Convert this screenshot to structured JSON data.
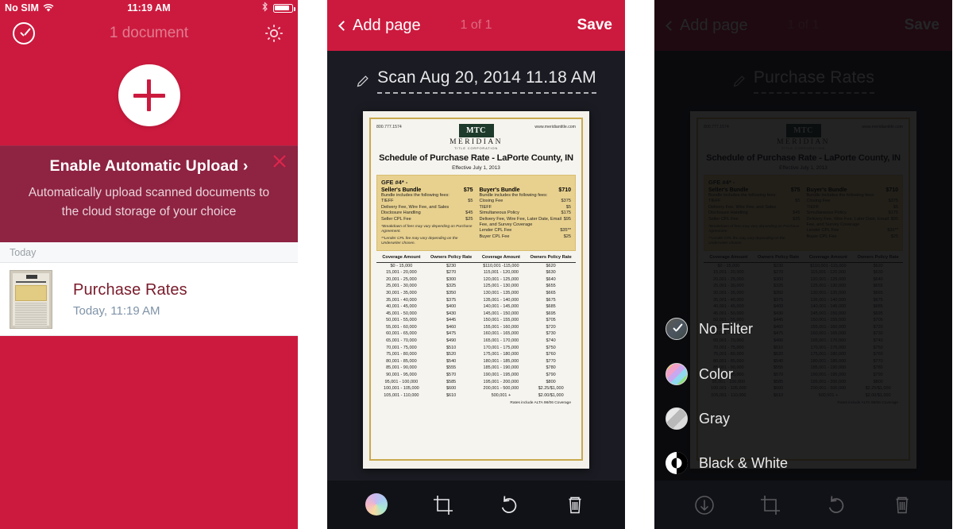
{
  "brand": {
    "red": "#CC1A3E",
    "banner_maroon": "#8E2342",
    "dark": "#1B1C23"
  },
  "panel1": {
    "status_bar": {
      "carrier": "No SIM",
      "time": "11:19 AM",
      "wifi_icon": "wifi-icon",
      "bluetooth_icon": "bluetooth-icon",
      "battery_icon": "battery-icon"
    },
    "navbar": {
      "select_icon": "check-circle-icon",
      "title": "1 document",
      "settings_icon": "gear-icon"
    },
    "add_button": {
      "icon": "plus-icon",
      "label": ""
    },
    "banner": {
      "title": "Enable Automatic Upload ›",
      "subtitle": "Automatically upload scanned documents to the cloud storage of your choice",
      "close_icon": "close-icon"
    },
    "list": {
      "section_header": "Today",
      "items": [
        {
          "title": "Purchase Rates",
          "subtitle": "Today, 11:19 AM",
          "thumbnail": "document-thumbnail"
        }
      ]
    }
  },
  "panel2": {
    "navbar": {
      "back_label": "Add page",
      "back_icon": "chevron-left-icon",
      "count": "1 of 1",
      "save_label": "Save"
    },
    "doc_title": {
      "text": "Scan Aug 20, 2014 11.18 AM",
      "edit_icon": "pencil-icon"
    },
    "toolbar": [
      {
        "name": "filter-button",
        "icon": "color-wheel-icon",
        "label": ""
      },
      {
        "name": "crop-button",
        "icon": "crop-icon",
        "label": ""
      },
      {
        "name": "rotate-button",
        "icon": "rotate-left-icon",
        "label": ""
      },
      {
        "name": "delete-button",
        "icon": "trash-icon",
        "label": ""
      }
    ]
  },
  "panel3": {
    "navbar": {
      "back_label": "Add page",
      "back_icon": "chevron-left-icon",
      "count": "1 of 1",
      "save_label": "Save"
    },
    "doc_title": {
      "text": "Purchase Rates",
      "edit_icon": "pencil-icon"
    },
    "filter_menu": {
      "options": [
        {
          "label": "No Filter",
          "icon": "filter-none-swatch",
          "selected": true
        },
        {
          "label": "Color",
          "icon": "filter-color-swatch",
          "selected": false
        },
        {
          "label": "Gray",
          "icon": "filter-gray-swatch",
          "selected": false
        },
        {
          "label": "Black & White",
          "icon": "filter-bw-swatch",
          "selected": false
        }
      ]
    },
    "toolbar": [
      {
        "name": "collapse-button",
        "icon": "arrow-down-circle-icon",
        "label": ""
      },
      {
        "name": "crop-button",
        "icon": "crop-icon",
        "label": ""
      },
      {
        "name": "rotate-button",
        "icon": "rotate-left-icon",
        "label": ""
      },
      {
        "name": "delete-button",
        "icon": "trash-icon",
        "label": ""
      }
    ]
  },
  "scanned_document": {
    "phone": "800.777.1574",
    "website": "www.meridiantitle.com",
    "logo_mark": "MTC",
    "logo_name": "MERIDIAN",
    "logo_sub": "TITLE CORPORATION",
    "title": "Schedule of Purchase Rate - LaPorte County, IN",
    "effective": "Effective July 1, 2013",
    "gfe_header": "GFE #4* -",
    "sellers": {
      "name": "Seller's Bundle",
      "dots": "....................",
      "price": "$75",
      "includes": "Bundle includes the following fees:",
      "fees": [
        {
          "label": "TIEFF",
          "value": "$5"
        },
        {
          "label": "Delivery Fee, Wire Fee, and Sales",
          "value": ""
        },
        {
          "label": "Disclosure Handling",
          "value": "$45"
        },
        {
          "label": "Seller CPL Fee",
          "value": "$25"
        }
      ]
    },
    "buyers": {
      "name": "Buyer's Bundle",
      "dots": "....................",
      "price": "$710",
      "includes": "Bundle includes the following fees:",
      "fees": [
        {
          "label": "Closing Fee",
          "value": "$375"
        },
        {
          "label": "TIEFF",
          "value": "$5"
        },
        {
          "label": "Simultaneous Policy",
          "value": "$175"
        },
        {
          "label": "Delivery Fee, Wire Fee, Later Date, Email Fee, and Survey Coverage",
          "value": "$95"
        },
        {
          "label": "Lender CPL Fee",
          "value": "$35**"
        },
        {
          "label": "Buyer CPL Fee",
          "value": "$25"
        }
      ]
    },
    "notes": [
      "*Breakdown of fees may vary depending on Purchase Agreement.",
      "**Lender CPL fee may vary depending on the Underwriter chosen."
    ],
    "table_headers": [
      "Coverage Amount",
      "Owners Policy Rate",
      "Coverage Amount",
      "Owners Policy Rate"
    ],
    "table_rows": [
      [
        "$0 - 15,000",
        "$230",
        "$110,001 -115,000",
        "$620"
      ],
      [
        "15,001 - 20,000",
        "$270",
        "115,001 - 120,000",
        "$630"
      ],
      [
        "20,001 - 25,000",
        "$300",
        "120,001 - 125,000",
        "$640"
      ],
      [
        "25,001 - 30,000",
        "$325",
        "125,001 - 130,000",
        "$655"
      ],
      [
        "30,001 - 35,000",
        "$350",
        "130,001 - 135,000",
        "$665"
      ],
      [
        "35,001 - 40,000",
        "$375",
        "135,001 - 140,000",
        "$675"
      ],
      [
        "40,001 - 45,000",
        "$400",
        "140,001 - 145,000",
        "$685"
      ],
      [
        "45,001 - 50,000",
        "$430",
        "145,001 - 150,000",
        "$695"
      ],
      [
        "50,001 - 55,000",
        "$445",
        "150,001 - 155,000",
        "$705"
      ],
      [
        "55,001 - 60,000",
        "$460",
        "155,001 - 160,000",
        "$720"
      ],
      [
        "60,001 - 65,000",
        "$475",
        "160,001 - 165,000",
        "$730"
      ],
      [
        "65,001 - 70,000",
        "$490",
        "165,001 - 170,000",
        "$740"
      ],
      [
        "70,001 - 75,000",
        "$510",
        "170,001 - 175,000",
        "$750"
      ],
      [
        "75,001 - 80,000",
        "$520",
        "175,001 - 180,000",
        "$760"
      ],
      [
        "80,001 - 85,000",
        "$540",
        "180,001 - 185,000",
        "$770"
      ],
      [
        "85,001 - 90,000",
        "$555",
        "185,001 - 190,000",
        "$780"
      ],
      [
        "90,001 - 95,000",
        "$570",
        "190,001 - 195,000",
        "$790"
      ],
      [
        "95,001 - 100,000",
        "$585",
        "195,001 - 200,000",
        "$800"
      ],
      [
        "100,001 - 105,000",
        "$600",
        "200,001 - 500,000",
        "$2.25/$1,000"
      ],
      [
        "105,001 - 110,000",
        "$610",
        "500,001 +",
        "$2.00/$1,000"
      ]
    ],
    "table_footer": "Rates include ALTA 98/06 Coverage"
  }
}
